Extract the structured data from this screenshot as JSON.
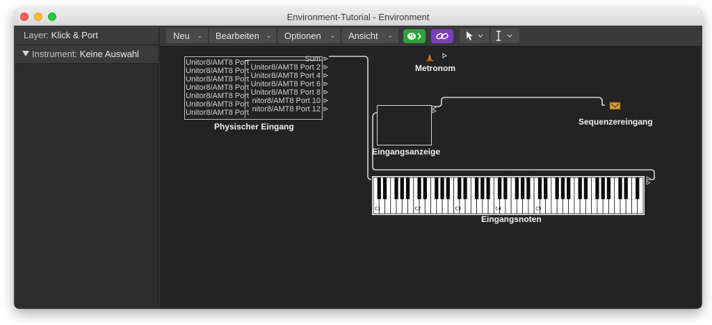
{
  "window": {
    "title": "Environment-Tutorial - Environment"
  },
  "inspector": {
    "layer_key": "Layer:",
    "layer_value": "Klick & Port",
    "instrument_key": "Instrument:",
    "instrument_value": "Keine Auswahl"
  },
  "toolbar": {
    "menus": [
      "Neu",
      "Bearbeiten",
      "Optionen",
      "Ansicht"
    ]
  },
  "canvas": {
    "physical_input": {
      "label": "Physischer Eingang",
      "left_ports": [
        "Unitor8/AMT8 Port",
        "Unitor8/AMT8 Port",
        "Unitor8/AMT8 Port",
        "Unitor8/AMT8 Port",
        "Unitor8/AMT8 Port",
        "Unitor8/AMT8 Port",
        "Unitor8/AMT8 Port"
      ],
      "right_ports": [
        "Sum",
        "Unitor8/AMT8 Port 2",
        "Unitor8/AMT8 Port 4",
        "Unitor8/AMT8 Port 6",
        "Unitor8/AMT8 Port 8",
        "nitor8/AMT8 Port 10",
        "nitor8/AMT8 Port 12"
      ]
    },
    "metronome_label": "Metronom",
    "monitor_label": "Eingangsanzeige",
    "sequencer_label": "Sequenzereingang",
    "keyboard": {
      "label": "Eingangsnoten",
      "octave_labels": [
        "C1",
        "C2",
        "C3",
        "C4",
        "C5"
      ]
    }
  }
}
